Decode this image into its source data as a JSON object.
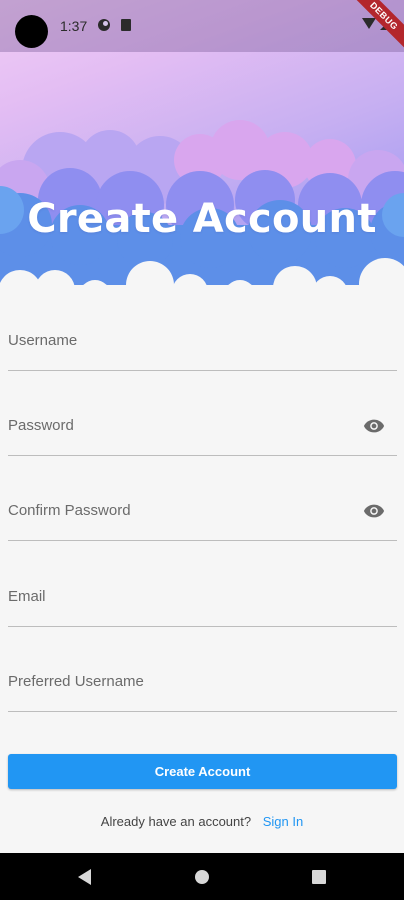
{
  "status_bar": {
    "time": "1:37",
    "debug_banner": "DEBUG"
  },
  "header": {
    "title": "Create Account"
  },
  "form": {
    "fields": [
      {
        "label": "Username",
        "type": "text"
      },
      {
        "label": "Password",
        "type": "password",
        "icon": "eye-icon"
      },
      {
        "label": "Confirm Password",
        "type": "password",
        "icon": "eye-icon"
      },
      {
        "label": "Email",
        "type": "email"
      },
      {
        "label": "Preferred Username",
        "type": "text"
      }
    ],
    "submit_label": "Create Account",
    "signin_prompt": "Already have an account?",
    "signin_link": "Sign In"
  },
  "colors": {
    "accent": "#2196f3",
    "background": "#f6f6f6",
    "header_gradient_start": "#f1cdf6",
    "header_gradient_end": "#9b93f1"
  }
}
